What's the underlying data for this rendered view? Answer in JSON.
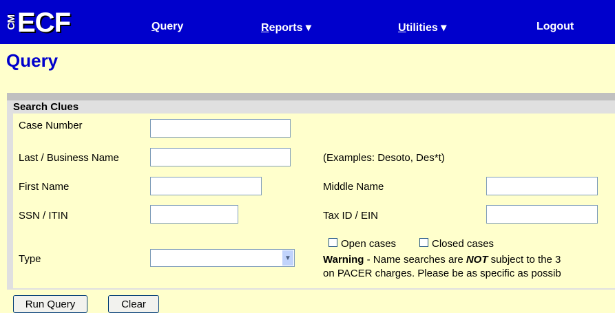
{
  "app": {
    "logo_cm": "CM",
    "logo_ecf": "ECF"
  },
  "nav": {
    "query": {
      "first": "Q",
      "rest": "uery"
    },
    "reports": {
      "first": "R",
      "rest": "eports",
      "arrow": " ▾"
    },
    "utilities": {
      "first": "U",
      "rest": "tilities",
      "arrow": " ▾"
    },
    "logout": "Logout"
  },
  "page_title": "Query",
  "form": {
    "legend": "Search Clues",
    "case_number_label": "Case Number",
    "case_number_value": "",
    "last_name_label": "Last / Business Name",
    "last_name_value": "",
    "examples": "(Examples: Desoto, Des*t)",
    "first_name_label": "First Name",
    "first_name_value": "",
    "middle_name_label": "Middle Name",
    "middle_name_value": "",
    "ssn_label": "SSN / ITIN",
    "ssn_value": "",
    "tax_id_label": "Tax ID / EIN",
    "tax_id_value": "",
    "type_label": "Type",
    "type_selected": "",
    "open_cases_label": "Open cases",
    "closed_cases_label": "Closed cases",
    "warning_bold": "Warning",
    "warning_text1": " - Name searches are ",
    "warning_not": "NOT",
    "warning_text2": " subject to the 3",
    "warning_line2": "on PACER charges. Please be as specific as possib"
  },
  "buttons": {
    "run_query": "Run Query",
    "clear": "Clear"
  },
  "colors": {
    "nav_bg": "#0000cc",
    "page_bg": "#ffffcc",
    "title": "#0000cc"
  }
}
